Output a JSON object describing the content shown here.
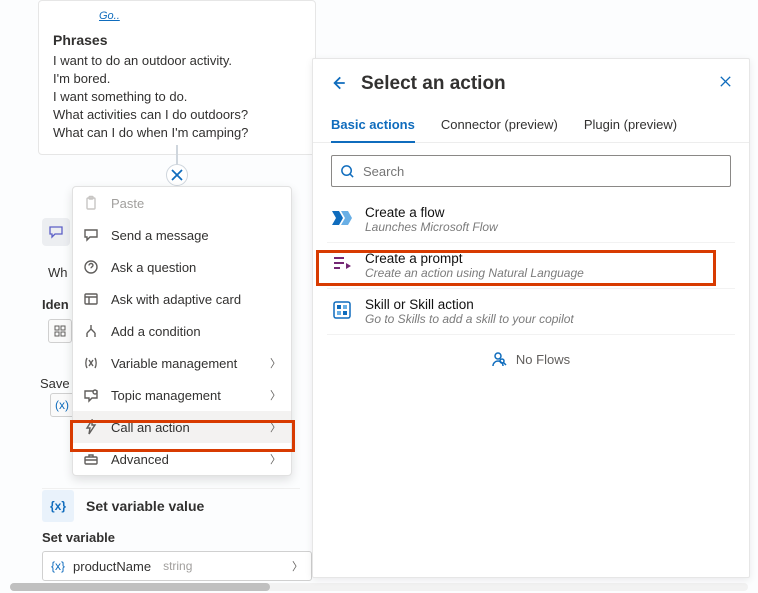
{
  "phrases_card": {
    "link_fragment": "Go..",
    "title": "Phrases",
    "lines": [
      "I want to do an outdoor activity.",
      "I'm bored.",
      "I want something to do.",
      "What activities can I do outdoors?",
      "What can I do when I'm camping?"
    ]
  },
  "underlying": {
    "wh": "Wh",
    "ident": "Iden",
    "save": "Save",
    "var_chip": "(x)",
    "set_var_value": "Set variable value",
    "set_var_header": "Set variable",
    "var_name": "productName",
    "var_type": "string"
  },
  "ctx_menu": {
    "paste": "Paste",
    "send_message": "Send a message",
    "ask_question": "Ask a question",
    "ask_adaptive": "Ask with adaptive card",
    "add_condition": "Add a condition",
    "variable_mgmt": "Variable management",
    "topic_mgmt": "Topic management",
    "call_action": "Call an action",
    "advanced": "Advanced"
  },
  "panel": {
    "title": "Select an action",
    "tabs": {
      "basic": "Basic actions",
      "connector": "Connector (preview)",
      "plugin": "Plugin (preview)"
    },
    "search_placeholder": "Search",
    "rows": {
      "flow": {
        "title": "Create a flow",
        "sub": "Launches Microsoft Flow"
      },
      "prompt": {
        "title": "Create a prompt",
        "sub": "Create an action using Natural Language"
      },
      "skill": {
        "title": "Skill or Skill action",
        "sub": "Go to Skills to add a skill to your copilot"
      }
    },
    "no_flows": "No Flows"
  }
}
